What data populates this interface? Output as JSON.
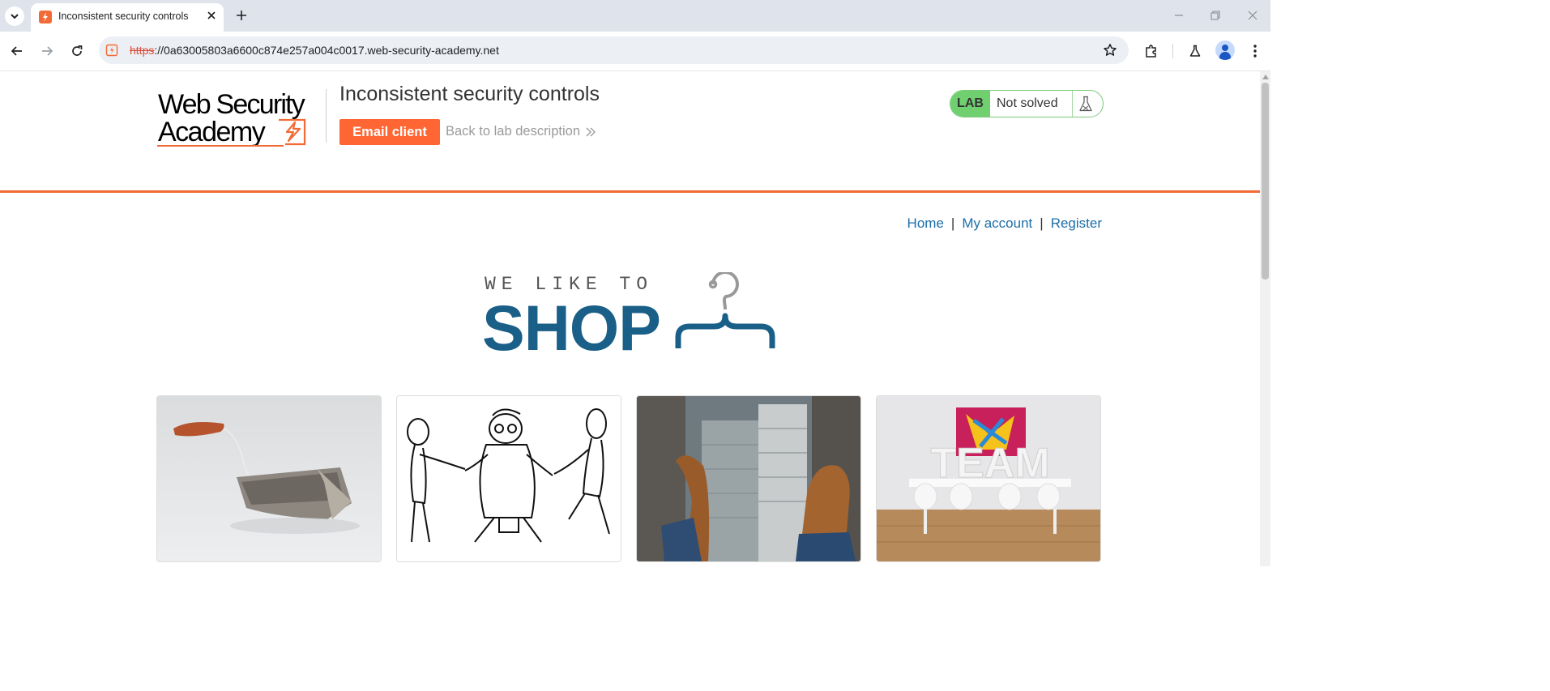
{
  "browser": {
    "tab_title": "Inconsistent security controls",
    "url_scheme": "https",
    "url_rest": "://0a63005803a6600c874e257a004c0017.web-security-academy.net"
  },
  "header": {
    "logo_line1": "Web Security",
    "logo_line2": "Academy",
    "lab_title": "Inconsistent security controls",
    "email_client_label": "Email client",
    "back_link_label": "Back to lab description",
    "lab_badge": "LAB",
    "lab_status": "Not solved"
  },
  "nav": {
    "home": "Home",
    "separator": "|",
    "my_account": "My account",
    "register": "Register"
  },
  "shop_logo": {
    "tagline": "WE LIKE TO",
    "word": "SHOP"
  },
  "products": [
    {
      "image": "tea-bag-image"
    },
    {
      "image": "tug-of-war-cartoon-image"
    },
    {
      "image": "shoes-over-skyscraper-image"
    },
    {
      "image": "team-meeting-room-image",
      "sign_text": "TEAM"
    }
  ],
  "colors": {
    "accent": "#ff6633",
    "lab_green": "#70cf6f",
    "link": "#1c6ea8",
    "shop_blue": "#1a5f87"
  }
}
